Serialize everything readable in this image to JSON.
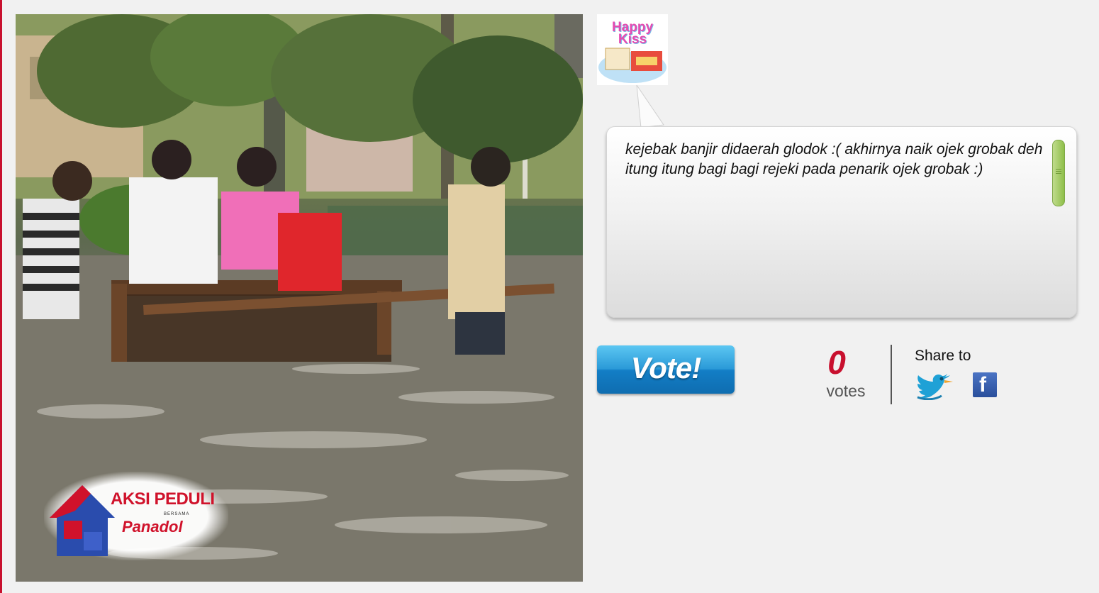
{
  "post": {
    "caption": "kejebak banjir didaerah glodok :( akhirnya naik ojek grobak deh itung itung bagi bagi rejeki pada penarik ojek grobak :)"
  },
  "avatar": {
    "brand_text": "Happy Kiss"
  },
  "photo_logo": {
    "line1": "AKSI PEDULI",
    "line2": "BERSAMA",
    "line3": "Panadol"
  },
  "vote": {
    "button_label": "Vote!",
    "count": "0",
    "unit": "votes"
  },
  "share": {
    "label": "Share to",
    "networks": [
      "twitter-icon",
      "facebook-icon"
    ],
    "facebook_glyph": "f"
  },
  "colors": {
    "accent_red": "#c8102e",
    "vote_blue": "#2b9ad8",
    "scroll_green": "#8fbf4a",
    "page_bg": "#f1f1f1"
  }
}
